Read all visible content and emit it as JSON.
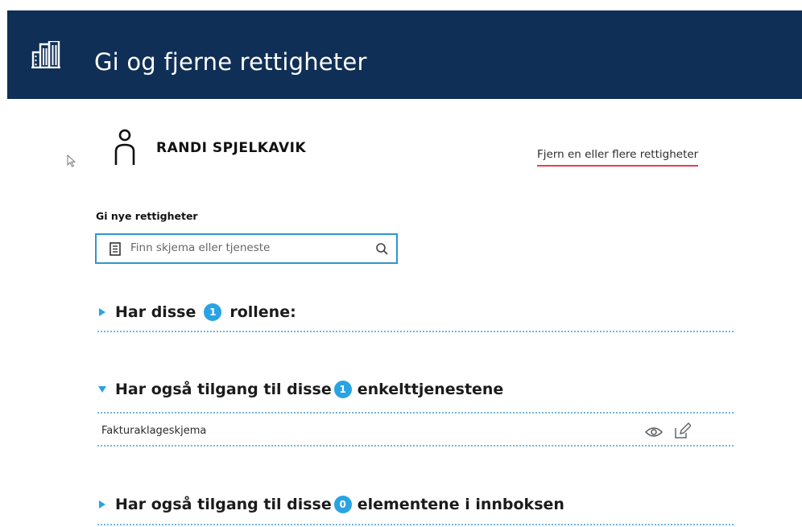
{
  "header": {
    "title": "Gi og fjerne rettigheter",
    "logo_icon": "building-icon",
    "background": "#0f2f56"
  },
  "user": {
    "name": "RANDI SPJELKAVIK",
    "icon": "person-icon"
  },
  "remove_link": {
    "label": "Fjern en eller flere rettigheter",
    "underline_color": "#e6404f"
  },
  "grant": {
    "label": "Gi nye rettigheter",
    "search": {
      "placeholder": "Finn skjema eller tjeneste",
      "value": "",
      "leading_icon": "document-icon",
      "trailing_icon": "search-icon"
    }
  },
  "sections": [
    {
      "expanded": false,
      "prefix": "Har disse",
      "count": "1",
      "suffix": "rollene:"
    },
    {
      "expanded": true,
      "prefix": "Har også tilgang til disse",
      "count": "1",
      "suffix": "enkelttjenestene",
      "items": [
        {
          "name": "Fakturaklageskjema",
          "actions": [
            "eye-icon",
            "edit-icon"
          ]
        }
      ]
    },
    {
      "expanded": false,
      "prefix": "Har også tilgang til disse",
      "count": "0",
      "suffix": "elementene i innboksen"
    }
  ],
  "colors": {
    "accent": "#2aa3e3",
    "search_border": "#2f95d0",
    "divider": "#76b4de"
  }
}
